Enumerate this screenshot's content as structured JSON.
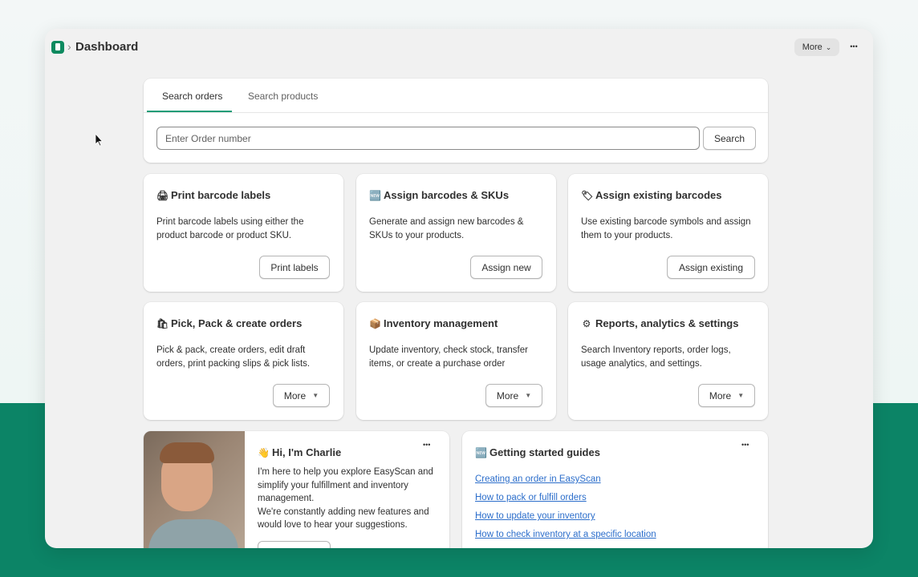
{
  "header": {
    "title": "Dashboard",
    "breadcrumb_separator": "›",
    "more_label": "More",
    "dots_label": "•••"
  },
  "search": {
    "tabs": [
      {
        "label": "Search orders",
        "active": true
      },
      {
        "label": "Search products",
        "active": false
      }
    ],
    "placeholder": "Enter Order number",
    "button_label": "Search"
  },
  "cards": [
    {
      "icon": "printer-icon",
      "emoji": "🖨",
      "title": "Print barcode labels",
      "description": "Print barcode labels using either the product barcode or product SKU.",
      "button": "Print labels",
      "dropdown": false
    },
    {
      "icon": "new-icon",
      "emoji": "🆕",
      "title": "Assign barcodes & SKUs",
      "description": "Generate and assign new barcodes & SKUs to your products.",
      "button": "Assign new",
      "dropdown": false
    },
    {
      "icon": "label-icon",
      "emoji": "🏷",
      "title": "Assign existing barcodes",
      "description": "Use existing barcode symbols and assign them to your products.",
      "button": "Assign existing",
      "dropdown": false
    },
    {
      "icon": "shopping-bag-icon",
      "emoji": "🛍",
      "title": "Pick, Pack & create orders",
      "description": "Pick & pack, create orders, edit draft orders, print packing slips & pick lists.",
      "button": "More",
      "dropdown": true
    },
    {
      "icon": "package-icon",
      "emoji": "📦",
      "title": "Inventory management",
      "description": "Update inventory, check stock, transfer items, or create a purchase order",
      "button": "More",
      "dropdown": true
    },
    {
      "icon": "gear-icon",
      "emoji": "⚙",
      "title": "Reports, analytics & settings",
      "description": "Search Inventory reports, order logs, usage analytics, and settings.",
      "button": "More",
      "dropdown": true
    }
  ],
  "charlie": {
    "emoji": "👋",
    "title": "Hi, I'm Charlie",
    "body": "I'm here to help you explore EasyScan and simplify your fulfillment and inventory management.\nWe're constantly adding new features and would love to hear your suggestions.",
    "dots_label": "•••"
  },
  "guides": {
    "emoji": "🆕",
    "title": "Getting started guides",
    "dots_label": "•••",
    "links": [
      "Creating an order in EasyScan",
      "How to pack or fulfill orders",
      "How to update your inventory",
      "How to check inventory at a specific location"
    ]
  },
  "colors": {
    "accent": "#1a9c77",
    "link": "#2c6ecb",
    "background_green": "#0c8466"
  }
}
